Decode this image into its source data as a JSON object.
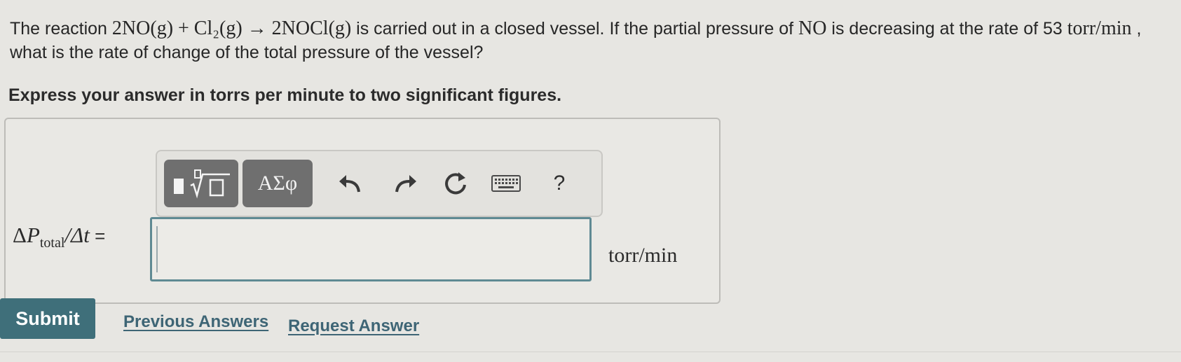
{
  "question": {
    "intro": "The reaction ",
    "reaction": "2NO(g) + Cl₂(g) → 2NOCl(g)",
    "mid": " is carried out in a closed vessel. If the partial pressure of ",
    "species": "NO",
    "after_species": " is decreasing at the rate of 53 ",
    "rate_unit": "torr/min",
    "end": " , what is the rate of change of the total pressure of the vessel?"
  },
  "instruction": "Express your answer in torrs per minute to two significant figures.",
  "toolbar": {
    "greek_label": "ΑΣφ",
    "help_label": "?",
    "icons": [
      "templates-icon",
      "undo-icon",
      "redo-icon",
      "reset-icon",
      "keyboard-icon",
      "help-icon"
    ]
  },
  "answer": {
    "label_delta": "Δ",
    "label_p": "P",
    "label_sub": "total",
    "label_rest": "/Δt",
    "label_eq": " =",
    "value": "",
    "unit": "torr/min"
  },
  "actions": {
    "submit": "Submit",
    "previous": "Previous Answers",
    "request": "Request Answer"
  },
  "colors": {
    "submit_bg": "#3f6f7a",
    "link": "#3e6575",
    "toolbar_button": "#6f6f6f",
    "input_border": "#5f8a93"
  }
}
